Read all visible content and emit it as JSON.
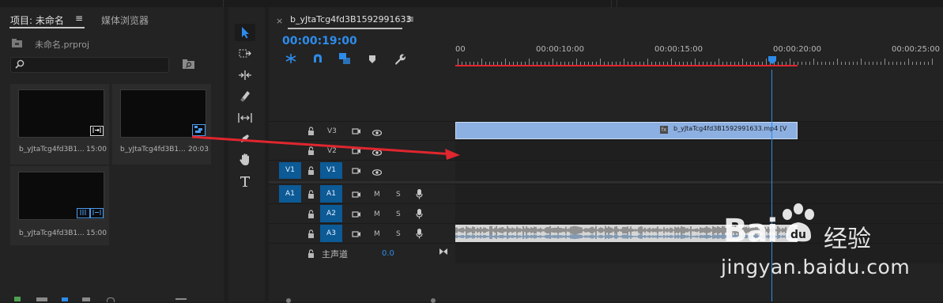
{
  "project_panel": {
    "tab_project": "项目: 未命名",
    "tab_menu": "≡",
    "tab_media": "媒体浏览器",
    "project_file": "未命名.prproj",
    "search_placeholder": "",
    "items": [
      {
        "name": "b_yJtaTcg4fd3B1...",
        "duration": "15:00"
      },
      {
        "name": "b_yJtaTcg4fd3B1...",
        "duration": "20:03"
      },
      {
        "name": "b_yJtaTcg4fd3B1...",
        "duration": "15:00"
      }
    ]
  },
  "timeline": {
    "close_glyph": "×",
    "sequence_name": "b_yJtaTcg4fd3B1592991633",
    "menu_glyph": "≡",
    "timecode": "00:00:19:00",
    "ruler_labels": [
      "00",
      "00:00:10:00",
      "00:00:15:00",
      "00:00:20:00",
      "00:00:25:00"
    ],
    "tracks": {
      "v3": "V3",
      "v2": "V2",
      "v1": "V1",
      "a1": "A1",
      "a2": "A2",
      "a3": "A3",
      "src_v1": "V1",
      "src_a1": "A1",
      "mute": "M",
      "solo": "S"
    },
    "master_label": "主声道",
    "master_value": "0.0",
    "clip_label": "b_yJtaTcg4fd3B1592991633.mp4 [V",
    "fx_badge": "fx"
  },
  "watermark": {
    "brand_left": "Bai",
    "brand_right": "经验",
    "url": "jingyan.baidu.com"
  },
  "colors": {
    "accent_blue": "#2d8ceb",
    "clip_blue": "#8db0e2",
    "target_blue": "#0c5a96",
    "arrow_red": "#e0262e",
    "work_area_red": "#e0262e"
  }
}
